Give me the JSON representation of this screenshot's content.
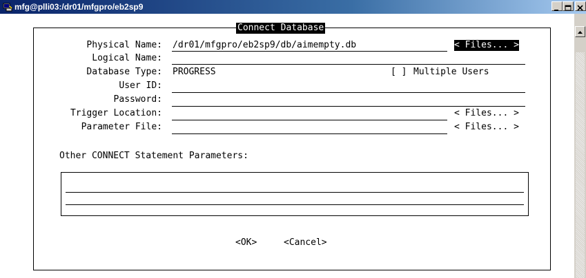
{
  "window": {
    "title": "mfg@plli03:/dr01/mfgpro/eb2sp9"
  },
  "dialog": {
    "title": "Connect Database",
    "fields": [
      {
        "label": "Physical Name:",
        "value": "/dr01/mfgpro/eb2sp9/db/aimempty.db",
        "files": "< Files... >"
      },
      {
        "label": "Logical Name:",
        "value": ""
      },
      {
        "label": "Database Type:",
        "value": "PROGRESS"
      },
      {
        "label": "User ID:",
        "value": ""
      },
      {
        "label": "Password:",
        "value": ""
      },
      {
        "label": "Trigger Location:",
        "value": "",
        "files": "< Files... >"
      },
      {
        "label": "Parameter File:",
        "value": "",
        "files": "< Files... >"
      }
    ],
    "multiple_users": {
      "box": "[ ]",
      "label": "Multiple Users"
    },
    "other_label": "Other CONNECT Statement Parameters:",
    "ok_label": "<OK>",
    "cancel_label": "<Cancel>"
  }
}
